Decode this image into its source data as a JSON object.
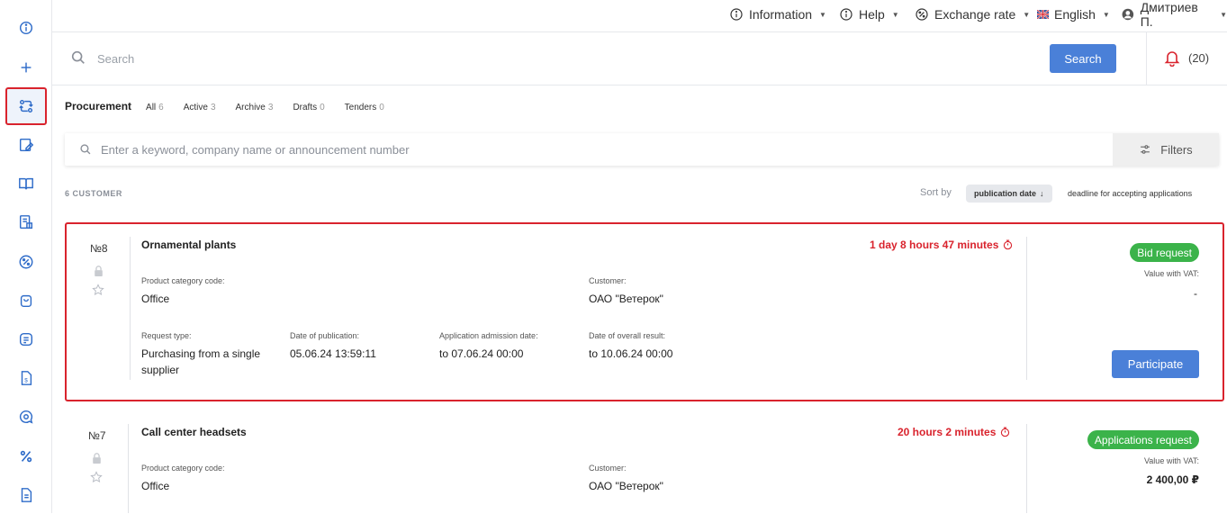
{
  "topbar": {
    "information": "Information",
    "help": "Help",
    "exchange_rate": "Exchange rate",
    "language": "English",
    "user": "Дмитриев П."
  },
  "search": {
    "placeholder": "Search",
    "button": "Search",
    "notifications_count": "(20)"
  },
  "procurement": {
    "title": "Procurement",
    "tabs": [
      {
        "label": "All",
        "count": "6"
      },
      {
        "label": "Active",
        "count": "3"
      },
      {
        "label": "Archive",
        "count": "3"
      },
      {
        "label": "Drafts",
        "count": "0"
      },
      {
        "label": "Tenders",
        "count": "0"
      }
    ]
  },
  "keyword_search": {
    "placeholder": "Enter a keyword, company name or announcement number",
    "filters": "Filters"
  },
  "results": {
    "count_label": "6 CUSTOMER",
    "sort_by": "Sort by",
    "sort_active": "publication date",
    "sort_active_arrow": "↓",
    "sort_other": "deadline for accepting applications"
  },
  "cards": [
    {
      "number": "№8",
      "title": "Ornamental plants",
      "timer": "1 day 8 hours 47 minutes",
      "category_label": "Product category code:",
      "category": "Office",
      "customer_label": "Customer:",
      "customer": "ОАО \"Ветерок\"",
      "request_type_label": "Request type:",
      "request_type": "Purchasing from a single supplier",
      "publication_label": "Date of publication:",
      "publication": "05.06.24 13:59:11",
      "admission_label": "Application admission date:",
      "admission": "to 07.06.24 00:00",
      "result_label": "Date of overall result:",
      "result": "to 10.06.24 00:00",
      "status": "Bid request",
      "vat_label": "Value with VAT:",
      "vat_value": "-",
      "action": "Participate"
    },
    {
      "number": "№7",
      "title": "Call center headsets",
      "timer": "20 hours 2 minutes",
      "category_label": "Product category code:",
      "category": "Office",
      "customer_label": "Customer:",
      "customer": "ОАО \"Ветерок\"",
      "status": "Applications request",
      "vat_label": "Value with VAT:",
      "vat_value": "2 400,00 ₽"
    }
  ],
  "sidebar": {
    "icons": [
      "info-icon",
      "plus-icon",
      "exchange-icon",
      "document-edit-icon",
      "book-icon",
      "report-icon",
      "percent-circle-icon",
      "bag-icon",
      "list-icon",
      "invoice-icon",
      "search-chat-icon",
      "percent-icon",
      "file-icon"
    ]
  },
  "colors": {
    "accent": "#4a80d8",
    "danger": "#d9232d",
    "success": "#3bb34a"
  }
}
